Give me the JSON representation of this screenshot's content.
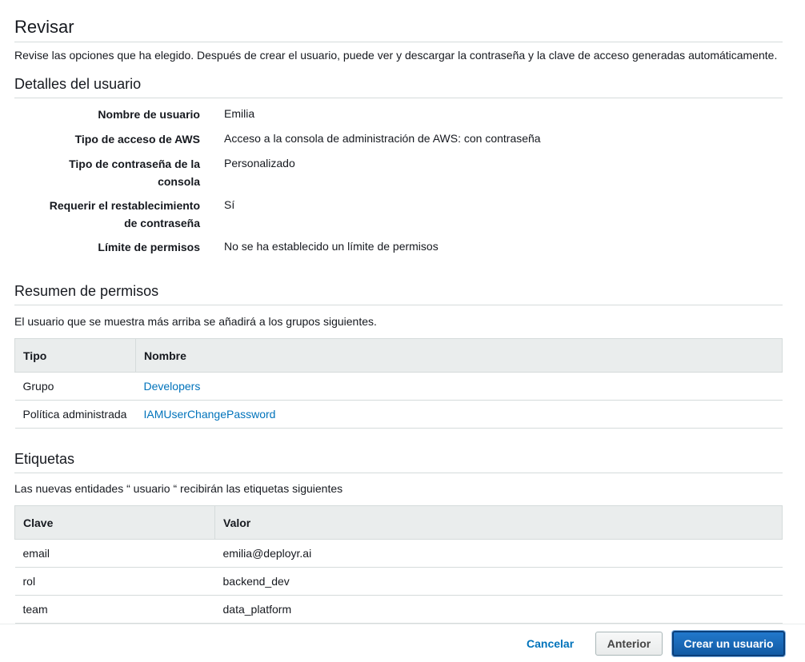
{
  "review": {
    "title": "Revisar",
    "intro": "Revise las opciones que ha elegido. Después de crear el usuario, puede ver y descargar la contraseña y la clave de acceso generadas automáticamente."
  },
  "user_details": {
    "title": "Detalles del usuario",
    "rows": [
      {
        "label": "Nombre de usuario",
        "value": "Emilia"
      },
      {
        "label": "Tipo de acceso de AWS",
        "value": "Acceso a la consola de administración de AWS: con contraseña"
      },
      {
        "label_line1": "Tipo de contraseña de la",
        "label_line2": "consola",
        "value": "Personalizado"
      },
      {
        "label_line1": "Requerir el restablecimiento",
        "label_line2": "de contraseña",
        "value": "Sí"
      },
      {
        "label": "Límite de permisos",
        "value": "No se ha establecido un límite de permisos"
      }
    ]
  },
  "permissions": {
    "title": "Resumen de permisos",
    "description": "El usuario que se muestra más arriba se añadirá a los grupos siguientes.",
    "columns": [
      "Tipo",
      "Nombre"
    ],
    "rows": [
      {
        "type": "Grupo",
        "name": "Developers"
      },
      {
        "type": "Política administrada",
        "name": "IAMUserChangePassword"
      }
    ]
  },
  "tags": {
    "title": "Etiquetas",
    "description": "Las nuevas entidades “ usuario “ recibirán las etiquetas siguientes",
    "columns": [
      "Clave",
      "Valor"
    ],
    "rows": [
      {
        "key": "email",
        "value": "emilia@deployr.ai"
      },
      {
        "key": "rol",
        "value": "backend_dev"
      },
      {
        "key": "team",
        "value": "data_platform"
      }
    ]
  },
  "footer": {
    "cancel_label": "Cancelar",
    "previous_label": "Anterior",
    "create_label": "Crear un usuario"
  },
  "colors": {
    "link": "#0073bb",
    "primary_button": "#1a6bbd",
    "table_header_bg": "#eaeded",
    "divider": "#d5dbdb"
  }
}
